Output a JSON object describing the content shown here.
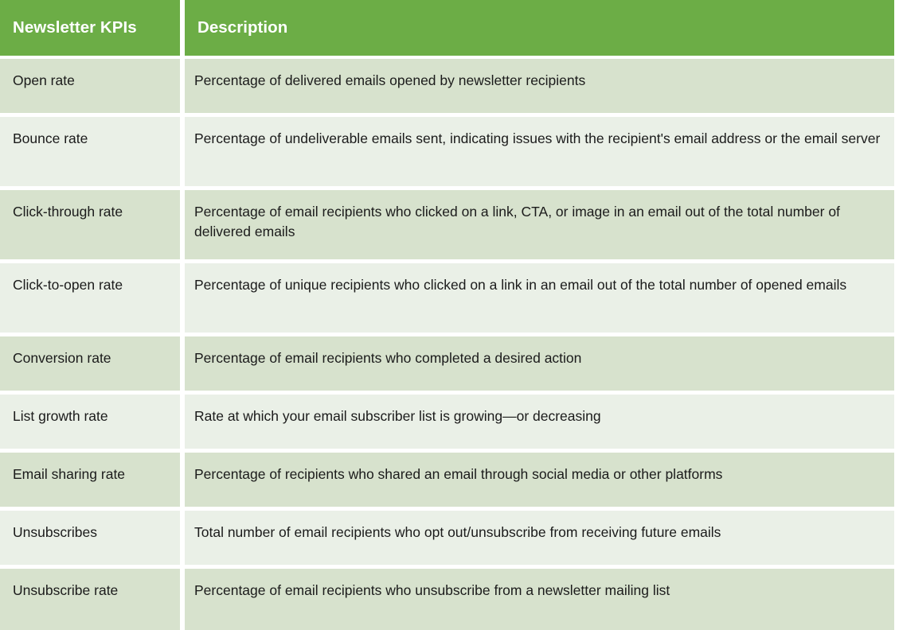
{
  "table": {
    "headers": {
      "kpi": "Newsletter KPIs",
      "description": "Description"
    },
    "colors": {
      "header_bg": "#6cad46",
      "header_text": "#ffffff",
      "row_dark": "#d7e2cd",
      "row_light": "#eaf0e7",
      "separator": "#ffffff",
      "body_text": "#1b1b1b"
    },
    "rows": [
      {
        "kpi": "Open rate",
        "description": "Percentage of delivered emails opened by newsletter recipients"
      },
      {
        "kpi": "Bounce rate",
        "description": "Percentage of undeliverable emails sent, indicating issues with the recipient's email address or the email server"
      },
      {
        "kpi": "Click-through rate",
        "description": "Percentage of email recipients who clicked on a link, CTA, or image in an email out of the total number of delivered emails"
      },
      {
        "kpi": "Click-to-open rate",
        "description": "Percentage of unique recipients who clicked on a link in an email out of the total number of opened emails"
      },
      {
        "kpi": "Conversion rate",
        "description": "Percentage of email recipients who completed a desired action"
      },
      {
        "kpi": "List growth rate",
        "description": "Rate at which your email subscriber list is growing—or decreasing"
      },
      {
        "kpi": "Email sharing rate",
        "description": "Percentage of recipients who shared an email through social media or other platforms"
      },
      {
        "kpi": "Unsubscribes",
        "description": "Total number of email recipients who opt out/unsubscribe from receiving future emails"
      },
      {
        "kpi": "Unsubscribe rate",
        "description": "Percentage of email recipients who unsubscribe from a newsletter mailing list"
      }
    ]
  }
}
